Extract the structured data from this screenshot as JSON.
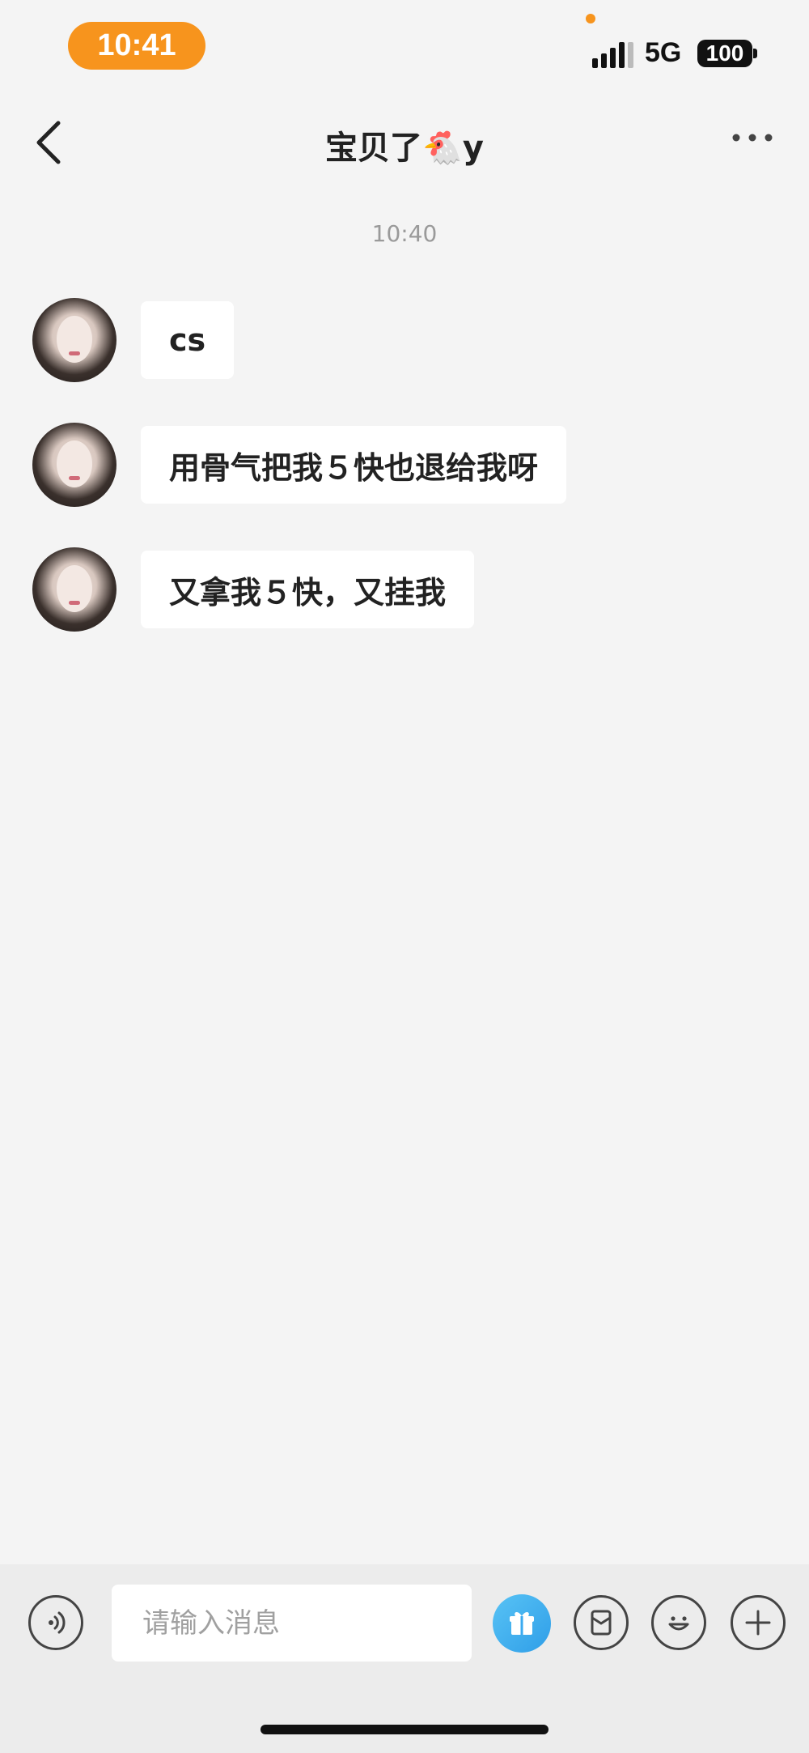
{
  "status_bar": {
    "time": "10:41",
    "network": "5G",
    "battery": "100"
  },
  "nav": {
    "title": "宝贝了🐔y"
  },
  "chat": {
    "timestamp": "10:40",
    "messages": [
      {
        "text": "cs"
      },
      {
        "text": "用骨气把我５快也退给我呀"
      },
      {
        "text": "又拿我５快，又挂我"
      }
    ]
  },
  "input": {
    "placeholder": "请输入消息"
  },
  "colors": {
    "accent_orange": "#f7941d",
    "gift_blue": "#3aaaf0",
    "background": "#f4f4f4",
    "toolbar": "#ececec"
  }
}
